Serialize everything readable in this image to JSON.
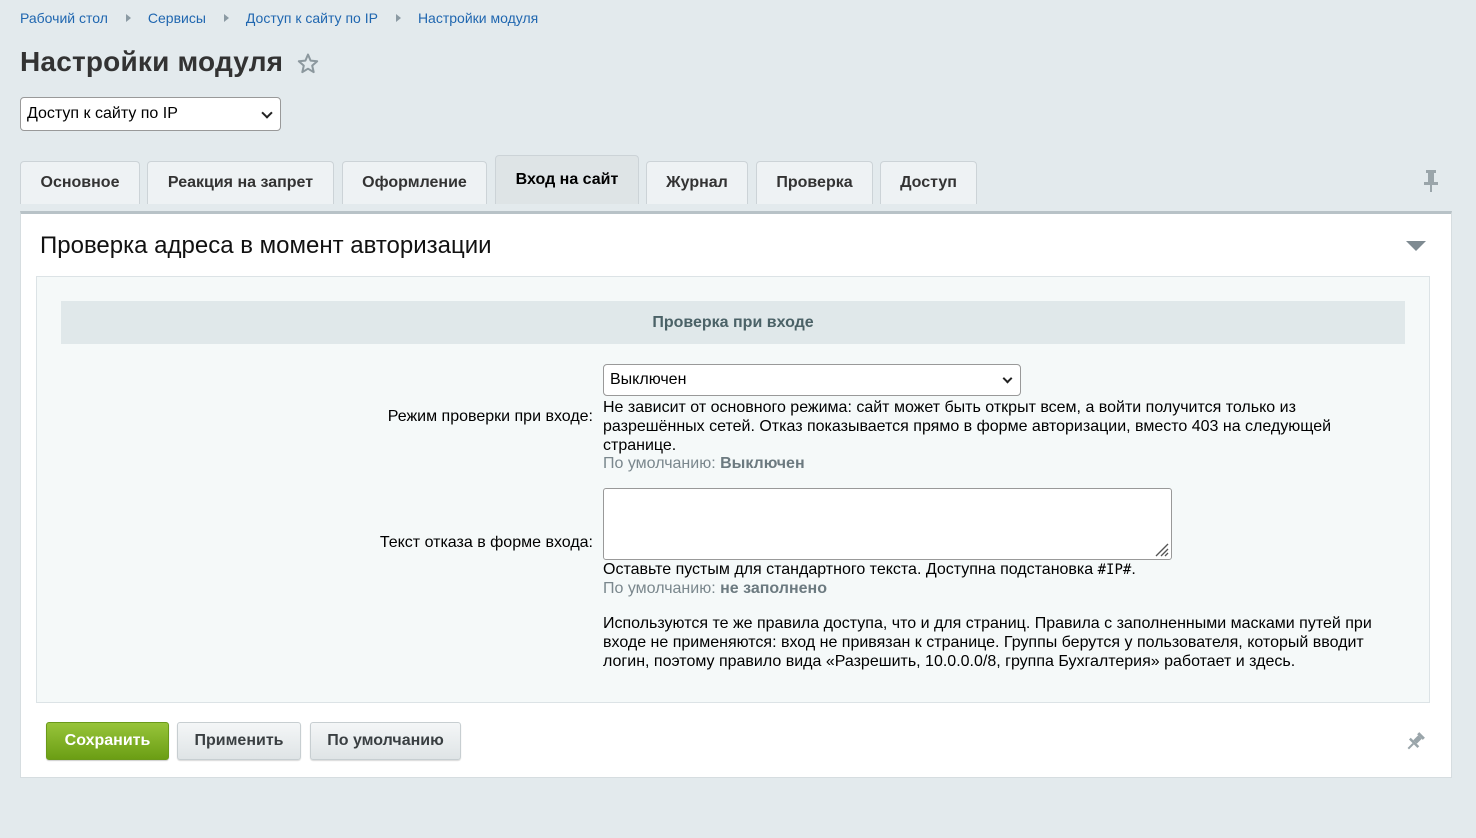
{
  "breadcrumb": {
    "items": [
      "Рабочий стол",
      "Сервисы",
      "Доступ к сайту по IP",
      "Настройки модуля"
    ]
  },
  "page": {
    "title": "Настройки модуля"
  },
  "module_select": {
    "value": "Доступ к сайту по IP"
  },
  "tabs": [
    {
      "label": "Основное",
      "active": false
    },
    {
      "label": "Реакция на запрет",
      "active": false
    },
    {
      "label": "Оформление",
      "active": false
    },
    {
      "label": "Вход на сайт",
      "active": true
    },
    {
      "label": "Журнал",
      "active": false
    },
    {
      "label": "Проверка",
      "active": false
    },
    {
      "label": "Доступ",
      "active": false
    }
  ],
  "section": {
    "title": "Проверка адреса в момент авторизации",
    "group_header": "Проверка при входе",
    "mode": {
      "label": "Режим проверки при входе:",
      "value": "Выключен",
      "desc_lines": [
        "Не зависит от основного режима: сайт может быть открыт всем, а войти получится только из",
        "разрешённых сетей. Отказ показывается прямо в форме авторизации, вместо 403 на следующей",
        "странице."
      ],
      "default_prefix": "По умолчанию:",
      "default_value": "Выключен"
    },
    "deny_text": {
      "label": "Текст отказа в форме входа:",
      "value": "",
      "hint_before": "Оставьте пустым для стандартного текста. Доступна подстановка",
      "hint_code": "#IP#",
      "hint_after": ".",
      "default_prefix": "По умолчанию:",
      "default_value": "не заполнено"
    },
    "note_lines": [
      "Используются те же правила доступа, что и для страниц. Правила с заполненными масками путей при",
      "входе не применяются: вход не привязан к странице. Группы берутся у пользователя, который вводит",
      "логин, поэтому правило вида «Разрешить, 10.0.0.0/8, группа Бухгалтерия» работает и здесь."
    ]
  },
  "buttons": {
    "save": "Сохранить",
    "apply": "Применить",
    "defaults": "По умолчанию"
  },
  "icons": {
    "star": "star-outline-icon",
    "pin": "pin-icon",
    "collapse": "triangle-down-icon"
  },
  "colors": {
    "page_bg": "#e3eaed",
    "link": "#2067b0",
    "save_button": "#7aab1c",
    "group_header_bg": "#e0e8ea"
  }
}
